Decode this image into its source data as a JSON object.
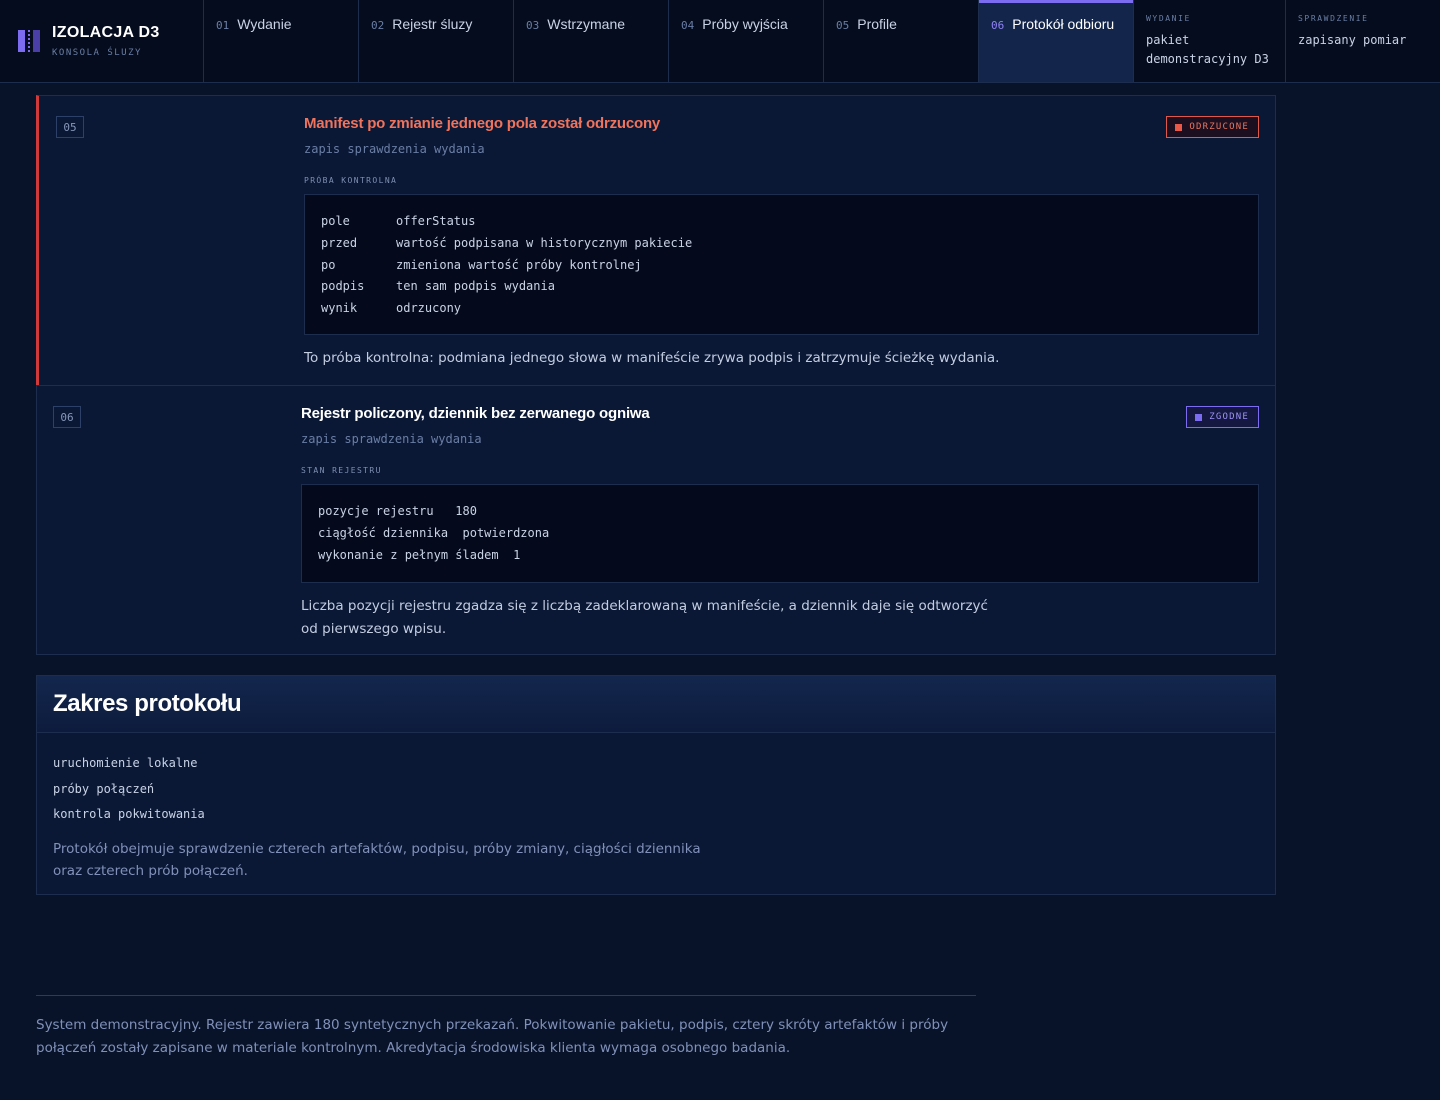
{
  "brand": {
    "title": "IZOLACJA D3",
    "subtitle": "KONSOLA ŚLUZY"
  },
  "tabs": [
    {
      "num": "01",
      "label": "Wydanie"
    },
    {
      "num": "02",
      "label": "Rejestr śluzy"
    },
    {
      "num": "03",
      "label": "Wstrzymane"
    },
    {
      "num": "04",
      "label": "Próby wyjścia"
    },
    {
      "num": "05",
      "label": "Profile"
    },
    {
      "num": "06",
      "label": "Protokół odbioru"
    }
  ],
  "active_tab": "06",
  "meta": {
    "release_key": "WYDANIE",
    "release_value": "pakiet demonstracyjny D3",
    "check_key": "SPRAWDZENIE",
    "check_value": "zapisany pomiar"
  },
  "checks": [
    {
      "index": "05",
      "title": "Manifest po zmianie jednego pola został odrzucony",
      "subtitle": "zapis sprawdzenia wydania",
      "section": "PRÓBA KONTROLNA",
      "badge": "ODRZUCONE",
      "status": "rejected",
      "rows": [
        {
          "k": "pole",
          "v": "offerStatus"
        },
        {
          "k": "przed",
          "v": "wartość podpisana w historycznym pakiecie"
        },
        {
          "k": "po",
          "v": "zmieniona wartość próby kontrolnej"
        },
        {
          "k": "podpis",
          "v": "ten sam podpis wydania"
        },
        {
          "k": "wynik",
          "v": "odrzucony"
        }
      ],
      "note": "To próba kontrolna: podmiana jednego słowa w manifeście zrywa podpis i zatrzymuje ścieżkę wydania."
    },
    {
      "index": "06",
      "title": "Rejestr policzony, dziennik bez zerwanego ogniwa",
      "subtitle": "zapis sprawdzenia wydania",
      "section": "STAN REJESTRU",
      "badge": "ZGODNE",
      "status": "ok",
      "rows": [
        {
          "k": "pozycje rejestru",
          "v": "180"
        },
        {
          "k": "ciągłość dziennika",
          "v": "potwierdzona"
        },
        {
          "k": "wykonanie z pełnym śladem",
          "v": "1"
        }
      ],
      "note": "Liczba pozycji rejestru zgadza się z liczbą zadeklarowaną w manifeście, a dziennik daje się odtworzyć od pierwszego wpisu."
    }
  ],
  "scope": {
    "title": "Zakres protokołu",
    "items": [
      "uruchomienie lokalne",
      "próby połączeń",
      "kontrola pokwitowania"
    ],
    "note": "Protokół obejmuje sprawdzenie czterech artefaktów, podpisu, próby zmiany, ciągłości dziennika oraz czterech prób połączeń."
  },
  "footer": "System demonstracyjny. Rejestr zawiera 180 syntetycznych przekazań. Pokwitowanie pakietu, podpis, cztery skróty artefaktów i próby połączeń zostały zapisane w materiale kontrolnym. Akredytacja środowiska klienta wymaga osobnego badania.",
  "colors": {
    "background": "#08132a",
    "accent": "#7c6cf0",
    "rejected": "#e8594a",
    "rejected_title": "#f0735c"
  }
}
